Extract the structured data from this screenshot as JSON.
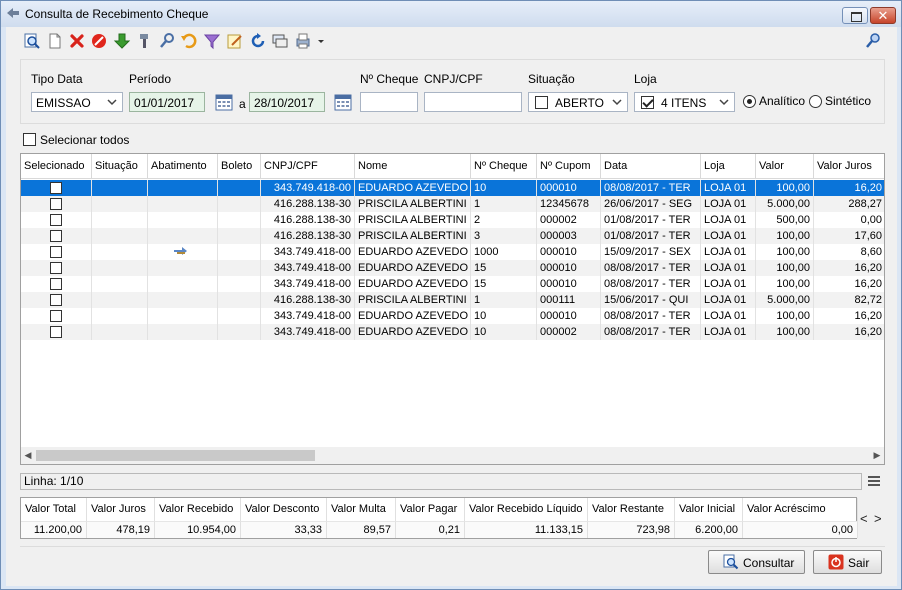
{
  "window": {
    "title": "Consulta de Recebimento Cheque"
  },
  "toolbar": {
    "icons": [
      "search-doc-icon",
      "new-doc-icon",
      "delete-x-icon",
      "cancel-icon",
      "down-arrow-icon",
      "tool-icon",
      "key-edit-icon",
      "undo-icon",
      "filter-icon",
      "edit-icon",
      "refresh-icon",
      "layers-icon",
      "print-icon",
      "dropdown-icon"
    ],
    "help_icon": "key-help-icon"
  },
  "filters": {
    "tipo_data_label": "Tipo Data",
    "tipo_data_value": "EMISSAO",
    "periodo_label": "Período",
    "periodo_start": "01/01/2017",
    "periodo_sep": "a",
    "periodo_end": "28/10/2017",
    "cheque_label": "Nº Cheque",
    "cheque_value": "",
    "cnpj_label": "CNPJ/CPF",
    "cnpj_value": "",
    "situacao_label": "Situação",
    "situacao_value": "ABERTO",
    "loja_label": "Loja",
    "loja_value": "4 ITENS",
    "analitico_label": "Analítico",
    "sintetico_label": "Sintético"
  },
  "select_all_label": "Selecionar todos",
  "grid": {
    "columns": [
      "Selecionado",
      "Situação",
      "Abatimento",
      "Boleto",
      "CNPJ/CPF",
      "Nome",
      "Nº Cheque",
      "Nº Cupom",
      "Data",
      "Loja",
      "Valor",
      "Valor Juros"
    ],
    "rows": [
      {
        "cnpj": "343.749.418-00",
        "nome": "EDUARDO AZEVEDO",
        "cheque": "10",
        "cupom": "000010",
        "data": "08/08/2017 - TER",
        "loja": "LOJA 01",
        "valor": "100,00",
        "juros": "16,20"
      },
      {
        "cnpj": "416.288.138-30",
        "nome": "PRISCILA ALBERTINI",
        "cheque": "1",
        "cupom": "12345678",
        "data": "26/06/2017 - SEG",
        "loja": "LOJA 01",
        "valor": "5.000,00",
        "juros": "288,27"
      },
      {
        "cnpj": "416.288.138-30",
        "nome": "PRISCILA ALBERTINI",
        "cheque": "2",
        "cupom": "000002",
        "data": "01/08/2017 - TER",
        "loja": "LOJA 01",
        "valor": "500,00",
        "juros": "0,00"
      },
      {
        "cnpj": "416.288.138-30",
        "nome": "PRISCILA ALBERTINI",
        "cheque": "3",
        "cupom": "000003",
        "data": "01/08/2017 - TER",
        "loja": "LOJA 01",
        "valor": "100,00",
        "juros": "17,60"
      },
      {
        "cnpj": "343.749.418-00",
        "nome": "EDUARDO AZEVEDO",
        "cheque": "1000",
        "cupom": "000010",
        "data": "15/09/2017 - SEX",
        "loja": "LOJA 01",
        "valor": "100,00",
        "juros": "8,60"
      },
      {
        "cnpj": "343.749.418-00",
        "nome": "EDUARDO AZEVEDO",
        "cheque": "15",
        "cupom": "000010",
        "data": "08/08/2017 - TER",
        "loja": "LOJA 01",
        "valor": "100,00",
        "juros": "16,20"
      },
      {
        "cnpj": "343.749.418-00",
        "nome": "EDUARDO AZEVEDO",
        "cheque": "15",
        "cupom": "000010",
        "data": "08/08/2017 - TER",
        "loja": "LOJA 01",
        "valor": "100,00",
        "juros": "16,20"
      },
      {
        "cnpj": "416.288.138-30",
        "nome": "PRISCILA ALBERTINI",
        "cheque": "1",
        "cupom": "000111",
        "data": "15/06/2017 - QUI",
        "loja": "LOJA 01",
        "valor": "5.000,00",
        "juros": "82,72"
      },
      {
        "cnpj": "343.749.418-00",
        "nome": "EDUARDO AZEVEDO",
        "cheque": "10",
        "cupom": "000010",
        "data": "08/08/2017 - TER",
        "loja": "LOJA 01",
        "valor": "100,00",
        "juros": "16,20"
      },
      {
        "cnpj": "343.749.418-00",
        "nome": "EDUARDO AZEVEDO",
        "cheque": "10",
        "cupom": "000002",
        "data": "08/08/2017 - TER",
        "loja": "LOJA 01",
        "valor": "100,00",
        "juros": "16,20"
      }
    ],
    "selected_row": 0,
    "abatimento_icon_row": 4,
    "abatimento_icon": "transfer-arrows-icon"
  },
  "status": {
    "linha": "Linha: 1/10"
  },
  "summary": {
    "headers": [
      "Valor Total",
      "Valor Juros",
      "Valor Recebido",
      "Valor Desconto",
      "Valor Multa",
      "Valor Pagar",
      "Valor Recebido Líquido",
      "Valor Restante",
      "Valor Inicial",
      "Valor Acréscimo"
    ],
    "values": [
      "11.200,00",
      "478,19",
      "10.954,00",
      "33,33",
      "89,57",
      "0,21",
      "11.133,15",
      "723,98",
      "6.200,00",
      "0,00"
    ],
    "nav_prev": "<",
    "nav_next": ">"
  },
  "buttons": {
    "consultar": "Consultar",
    "sair": "Sair"
  },
  "colors": {
    "selection": "#0a74d9",
    "window_frame": "#dbe6f4",
    "date_field": "#e6f4e8"
  }
}
